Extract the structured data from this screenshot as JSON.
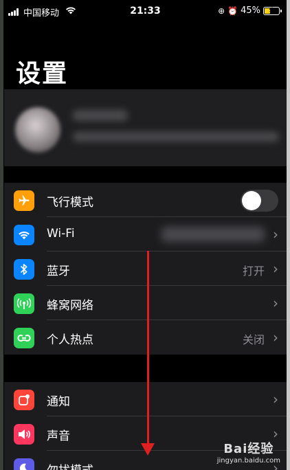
{
  "status_bar": {
    "carrier": "中国移动",
    "time": "21:33",
    "battery_percent": "45%",
    "signal_bars": 4,
    "battery_level": 0.45,
    "battery_color": "#ffd60a"
  },
  "page": {
    "title": "设置"
  },
  "section1": {
    "items": [
      {
        "label": "飞行模式",
        "icon": "airplane-icon",
        "color": "#ff9f0a",
        "toggle_on": false
      },
      {
        "label": "Wi-Fi",
        "icon": "wifi-icon",
        "color": "#0a84ff",
        "value": ""
      },
      {
        "label": "蓝牙",
        "icon": "bluetooth-icon",
        "color": "#0a84ff",
        "value": "打开"
      },
      {
        "label": "蜂窝网络",
        "icon": "cellular-icon",
        "color": "#30d158",
        "value": ""
      },
      {
        "label": "个人热点",
        "icon": "hotspot-icon",
        "color": "#30d158",
        "value": "关闭"
      }
    ]
  },
  "section2": {
    "items": [
      {
        "label": "通知",
        "icon": "notification-icon",
        "color": "#ff453a"
      },
      {
        "label": "声音",
        "icon": "sound-icon",
        "color": "#ff375f"
      },
      {
        "label": "勿扰模式",
        "icon": "moon-icon",
        "color": "#5e5ce6"
      }
    ]
  },
  "watermark": {
    "main": "Bai经验",
    "sub": "jingyan.baidu.com"
  }
}
